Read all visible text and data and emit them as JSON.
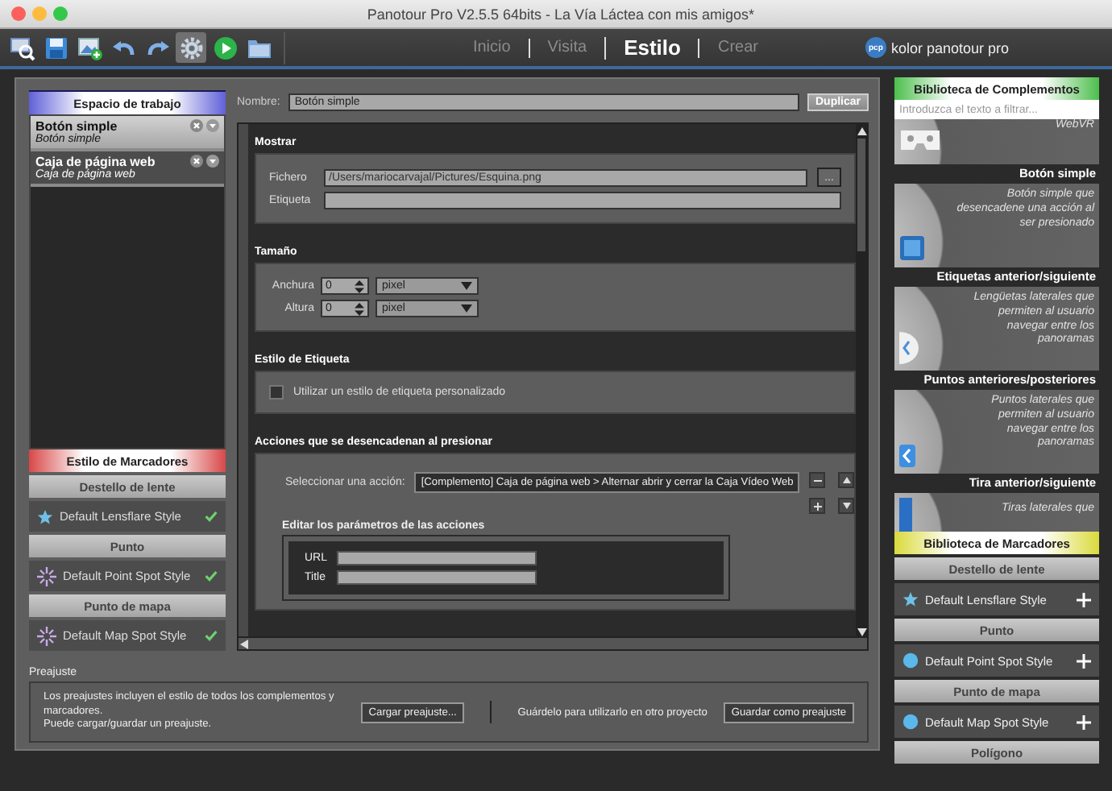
{
  "window": {
    "title": "Panotour Pro V2.5.5 64bits - La Vía Láctea con mis amigos*"
  },
  "toolbar": {
    "tools": [
      {
        "selected": false
      },
      {
        "selected": false
      },
      {
        "selected": false
      },
      {
        "selected": false
      },
      {
        "selected": false
      },
      {
        "selected": true
      },
      {
        "selected": false
      },
      {
        "selected": false
      }
    ],
    "nav": [
      {
        "label": "Inicio",
        "selected": false
      },
      {
        "label": "Visita",
        "selected": false
      },
      {
        "label": "Estilo",
        "selected": true
      },
      {
        "label": "Crear",
        "selected": false
      }
    ],
    "logo_mark": "pcp",
    "logo_text": "kolor panotour pro"
  },
  "workspace": {
    "title": "Espacio de trabajo",
    "items": [
      {
        "name": "Botón simple",
        "subtitle": "Botón simple",
        "selected": true
      },
      {
        "name": "Caja de página web",
        "subtitle": "Caja de página web",
        "selected": false
      }
    ]
  },
  "marker_styles": {
    "title": "Estilo de Marcadores",
    "groups": [
      {
        "category": "Destello de lente",
        "style": "Default Lensflare Style"
      },
      {
        "category": "Punto",
        "style": "Default Point Spot Style"
      },
      {
        "category": "Punto de mapa",
        "style": "Default Map Spot Style"
      }
    ]
  },
  "editor": {
    "name_label": "Nombre:",
    "name_value": "Botón simple",
    "duplicate": "Duplicar",
    "sections": [
      {
        "kind": "fields",
        "title": "Mostrar",
        "fields": [
          {
            "label": "Fichero",
            "value": "/Users/mariocarvajal/Pictures/Esquina.png",
            "browse": "..."
          },
          {
            "label": "Etiqueta"
          }
        ]
      },
      {
        "kind": "size",
        "title": "Tamaño",
        "rows": [
          {
            "label": "Anchura",
            "value": "0",
            "unit": "pixel"
          },
          {
            "label": "Altura",
            "value": "0",
            "unit": "pixel"
          }
        ]
      },
      {
        "kind": "checkbox",
        "title": "Estilo de Etiqueta",
        "label": "Utilizar un estilo de etiqueta personalizado",
        "checked": false
      },
      {
        "kind": "actions",
        "title": "Acciones que se desencadenan al presionar",
        "select_label": "Seleccionar una acción:",
        "action": "[Complemento] Caja de página web > Alternar abrir y cerrar la Caja Vídeo Web",
        "params_title": "Editar los parámetros de las acciones",
        "params": [
          {
            "label": "URL"
          },
          {
            "label": "Title"
          }
        ]
      }
    ]
  },
  "preset": {
    "title": "Preajuste",
    "description": "Los preajustes incluyen el estilo de todos los complementos y marcadores.\nPuede cargar/guardar un preajuste.",
    "load": "Cargar preajuste...",
    "save_hint": "Guárdelo para utilizarlo en otro proyecto",
    "save": "Guardar como preajuste"
  },
  "plugin_library": {
    "title": "Biblioteca de Complementos",
    "filter_placeholder": "Introduzca el texto a filtrar...",
    "cards": [
      {
        "description": "WebVR"
      },
      {
        "title": "Botón simple",
        "description": "Botón simple que desencadene una acción al ser presionado"
      },
      {
        "title": "Etiquetas anterior/siguiente",
        "description": "Lengüetas laterales que permiten al usuario navegar entre los panoramas"
      },
      {
        "title": "Puntos anteriores/posteriores",
        "description": "Puntos laterales que permiten al usuario navegar entre los panoramas"
      },
      {
        "title": "Tira anterior/siguiente",
        "description": "Tiras laterales que"
      }
    ]
  },
  "marker_library": {
    "title": "Biblioteca de Marcadores",
    "groups": [
      {
        "category": "Destello de lente",
        "style": "Default Lensflare Style"
      },
      {
        "category": "Punto",
        "style": "Default Point Spot Style"
      },
      {
        "category": "Punto de mapa",
        "style": "Default Map Spot Style"
      },
      {
        "category": "Polígono"
      }
    ]
  }
}
